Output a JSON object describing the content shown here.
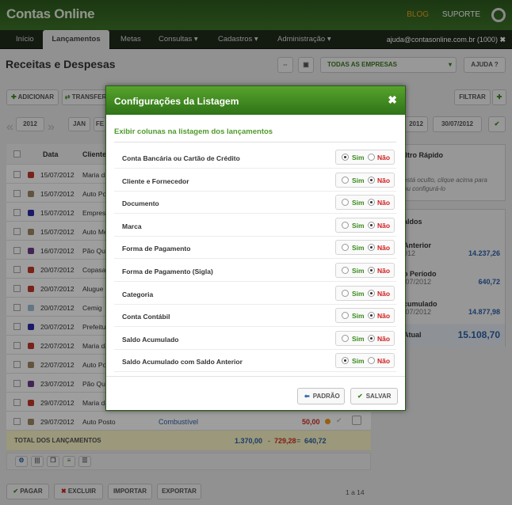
{
  "app": {
    "logo": "Contas Online",
    "blog": "BLOG",
    "suporte": "SUPORTE",
    "user": "ajuda@contasonline.com.br (1000)"
  },
  "nav": [
    "Início",
    "Lançamentos",
    "Metas",
    "Consultas ▾",
    "Cadastros ▾",
    "Administração ▾"
  ],
  "page": {
    "title": "Receitas e Despesas",
    "empresas": "TODAS AS EMPRESAS",
    "ajuda": "AJUDA",
    "adicionar": "ADICIONAR",
    "transferir": "TRANSFER",
    "filtrar": "FILTRAR",
    "year": "2012",
    "month1": "JAN",
    "month2": "FE",
    "date_from": "2012",
    "date_to": "30/07/2012"
  },
  "table": {
    "headers": [
      "Data",
      "Cliente"
    ],
    "rows": [
      {
        "date": "15/07/2012",
        "client": "Maria da",
        "color": "#c0392b"
      },
      {
        "date": "15/07/2012",
        "client": "Auto Pos",
        "color": "#a08866"
      },
      {
        "date": "15/07/2012",
        "client": "Empres",
        "color": "#2a2aa8"
      },
      {
        "date": "15/07/2012",
        "client": "Auto Me",
        "color": "#a08866"
      },
      {
        "date": "16/07/2012",
        "client": "Pão Qu",
        "color": "#6b3c8a"
      },
      {
        "date": "20/07/2012",
        "client": "Copasa",
        "color": "#c0392b"
      },
      {
        "date": "20/07/2012",
        "client": "Alugue",
        "color": "#c0392b"
      },
      {
        "date": "20/07/2012",
        "client": "Cemig",
        "color": "#9ec0d8"
      },
      {
        "date": "20/07/2012",
        "client": "Prefeitu",
        "color": "#2a2aa8"
      },
      {
        "date": "22/07/2012",
        "client": "Maria da",
        "color": "#c0392b"
      },
      {
        "date": "22/07/2012",
        "client": "Auto Pos",
        "color": "#a08866"
      },
      {
        "date": "23/07/2012",
        "client": "Pão Qu",
        "color": "#6b3c8a"
      },
      {
        "date": "29/07/2012",
        "client": "Maria da",
        "color": "#c0392b"
      },
      {
        "date": "29/07/2012",
        "client": "Auto Posto",
        "color": "#a08866"
      }
    ],
    "last_category": "Combustível",
    "last_value": "50,00",
    "total_label": "TOTAL DOS LANÇAMENTOS",
    "total_pos": "1.370,00",
    "total_neg": "729,28",
    "total": "640,72"
  },
  "right": {
    "filtro": "iltro Rápido",
    "filtro_text1": "está oculto, clique acima para",
    "filtro_text2": "ou configurá-lo",
    "saldos": "aldos",
    "s1_label": "Anterior",
    "s1_date": "012",
    "s1_val": "14.237,26",
    "s2_label": "o Período",
    "s2_date": "/07/2012",
    "s2_val": "640,72",
    "s3_label": "cumulado",
    "s3_date": "/07/2012",
    "s3_val": "14.877,98",
    "s4_label": "Atual",
    "s4_val": "15.108,70"
  },
  "footer": {
    "pagar": "PAGAR",
    "excluir": "EXCLUIR",
    "importar": "IMPORTAR",
    "exportar": "EXPORTAR",
    "pages": "1 a 14"
  },
  "modal": {
    "title": "Configurações da Listagem",
    "close": "✖",
    "subtitle": "Exibir colunas na listagem dos lançamentos",
    "sim": "Sim",
    "nao": "Não",
    "options": [
      {
        "label": "Conta Bancária ou Cartão de Crédito",
        "sim": true
      },
      {
        "label": "Cliente e Fornecedor",
        "sim": false
      },
      {
        "label": "Documento",
        "sim": false
      },
      {
        "label": "Marca",
        "sim": false
      },
      {
        "label": "Forma de Pagamento",
        "sim": false
      },
      {
        "label": "Forma de Pagamento (Sigla)",
        "sim": false
      },
      {
        "label": "Categoria",
        "sim": false
      },
      {
        "label": "Conta Contábil",
        "sim": false
      },
      {
        "label": "Saldo Acumulado",
        "sim": false
      },
      {
        "label": "Saldo Acumulado com Saldo Anterior",
        "sim": true
      }
    ],
    "padrao": "PADRÃO",
    "salvar": "SALVAR"
  }
}
